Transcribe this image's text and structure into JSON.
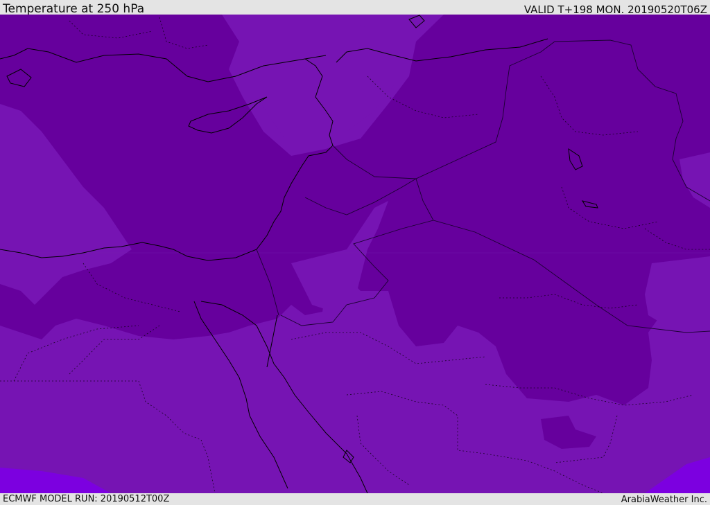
{
  "header": {
    "title": "Temperature at 250 hPa",
    "valid_time": "VALID T+198 MON. 20190520T06Z"
  },
  "footer": {
    "model_run": "ECMWF MODEL RUN: 20190512T00Z",
    "credit": "ArabiaWeather Inc."
  },
  "map": {
    "field": "Temperature at 250 hPa",
    "colors": {
      "dark_band": "#66009d",
      "mid_band": "#7614b3",
      "light_band": "#7c00e0",
      "coastline": "#000000",
      "border": "#1a0030"
    }
  }
}
